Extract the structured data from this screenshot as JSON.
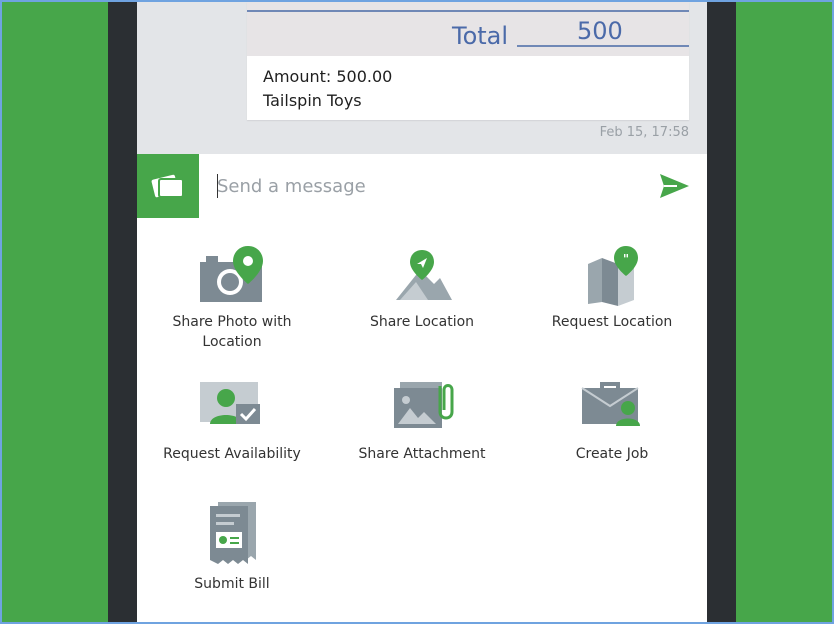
{
  "receipt": {
    "total_label": "Total",
    "total_value": "500",
    "amount_text": "Amount: 500.00",
    "merchant": "Tailspin Toys",
    "timestamp": "Feb 15, 17:58"
  },
  "composer": {
    "placeholder": "Send a message"
  },
  "actions": [
    {
      "label": "Share Photo with Location",
      "icon": "camera-location-icon"
    },
    {
      "label": "Share Location",
      "icon": "map-pin-icon"
    },
    {
      "label": "Request Location",
      "icon": "map-request-icon"
    },
    {
      "label": "Request Availability",
      "icon": "availability-icon"
    },
    {
      "label": "Share Attachment",
      "icon": "attachment-icon"
    },
    {
      "label": "Create Job",
      "icon": "briefcase-icon"
    },
    {
      "label": "Submit Bill",
      "icon": "bill-icon"
    }
  ],
  "colors": {
    "brand_green": "#47a64a",
    "icon_gray": "#7d8a93",
    "receipt_blue": "#4b6aa9"
  }
}
